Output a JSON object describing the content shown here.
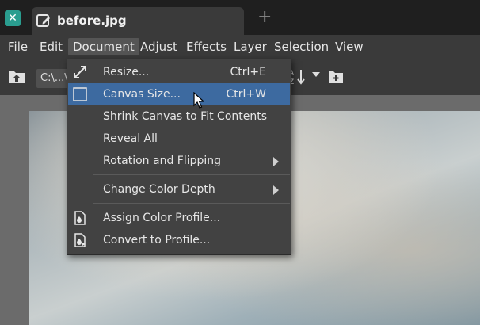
{
  "tab": {
    "title": "before.jpg"
  },
  "menubar": {
    "items": [
      {
        "label": "File"
      },
      {
        "label": "Edit"
      },
      {
        "label": "Document"
      },
      {
        "label": "Adjust"
      },
      {
        "label": "Effects"
      },
      {
        "label": "Layer"
      },
      {
        "label": "Selection"
      },
      {
        "label": "View"
      }
    ]
  },
  "toolbar": {
    "path": "C:\\...\\"
  },
  "document_menu": {
    "items": [
      {
        "label": "Resize...",
        "shortcut": "Ctrl+E",
        "icon": "resize-icon"
      },
      {
        "label": "Canvas Size...",
        "shortcut": "Ctrl+W",
        "icon": "canvas-size-icon"
      },
      {
        "label": "Shrink Canvas to Fit Contents",
        "shortcut": ""
      },
      {
        "label": "Reveal All",
        "shortcut": ""
      },
      {
        "label": "Rotation and Flipping",
        "shortcut": "",
        "submenu": true
      },
      {
        "label": "Change Color Depth",
        "shortcut": "",
        "submenu": true
      },
      {
        "label": "Assign Color Profile...",
        "shortcut": "",
        "icon": "color-profile-icon"
      },
      {
        "label": "Convert to Profile...",
        "shortcut": "",
        "icon": "convert-profile-icon"
      }
    ]
  },
  "colors": {
    "highlight": "#3d6aa0",
    "menu_bg": "#424242",
    "bar_bg": "#3a3a3a",
    "titlebar_bg": "#1f1f1f"
  }
}
